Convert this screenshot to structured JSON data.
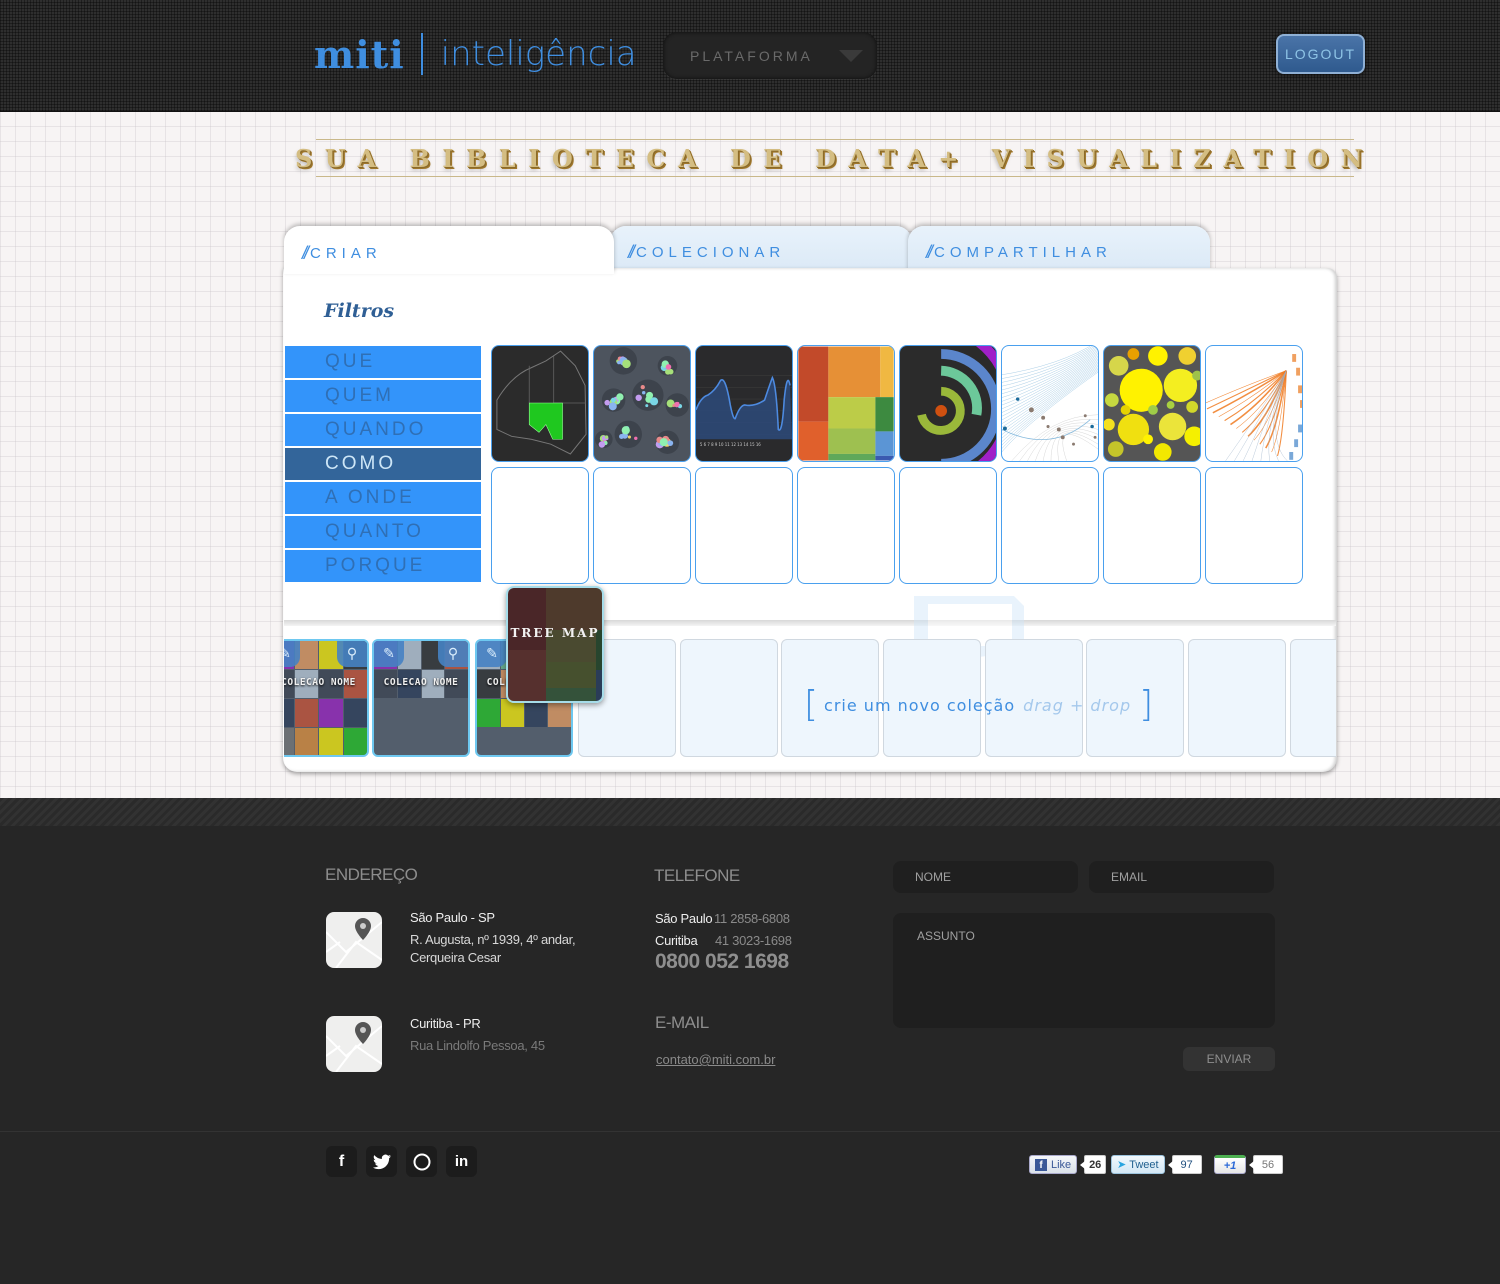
{
  "header": {
    "brand": "miti",
    "product": "inteligência",
    "platform_dropdown": "PLATAFORMA",
    "logout_label": "LOGOUT"
  },
  "banner": {
    "title": "SUA BIBLIOTECA DE DATA+ VISUALIZATION"
  },
  "tabs": [
    {
      "label": "CRIAR",
      "active": true
    },
    {
      "label": "COLECIONAR",
      "active": false
    },
    {
      "label": "COMPARTILHAR",
      "active": false
    }
  ],
  "filters": {
    "title": "Filtros",
    "items": [
      {
        "label": "QUE",
        "active": false
      },
      {
        "label": "QUEM",
        "active": false
      },
      {
        "label": "QUANDO",
        "active": false
      },
      {
        "label": "COMO",
        "active": true
      },
      {
        "label": "A ONDE",
        "active": false
      },
      {
        "label": "QUANTO",
        "active": false
      },
      {
        "label": "PORQUE",
        "active": false
      }
    ]
  },
  "gallery": {
    "thumbnails": [
      {
        "kind": "choropleth-map"
      },
      {
        "kind": "cluster-bubbles"
      },
      {
        "kind": "area-line-chart"
      },
      {
        "kind": "tree-map"
      },
      {
        "kind": "radial-bar"
      },
      {
        "kind": "network-arcs"
      },
      {
        "kind": "circle-packing"
      },
      {
        "kind": "edge-bundling"
      }
    ],
    "empty_slots": 8
  },
  "collections": {
    "items": [
      {
        "name": "COLECAO NOME",
        "fill": "full"
      },
      {
        "name": "COLECAO NOME",
        "fill": "partial"
      },
      {
        "name": "COLECAO NOME",
        "fill": "partial"
      }
    ],
    "empty_slots": 8,
    "drop_hint": "crie um novo coleção",
    "drop_hint_action": "drag + drop"
  },
  "drag_item": {
    "label": "TREE MAP"
  },
  "footer": {
    "address_heading": "ENDEREÇO",
    "addresses": [
      {
        "city": "São Paulo - SP",
        "line1": "R. Augusta, nº 1939, 4º andar,",
        "line2": "Cerqueira Cesar"
      },
      {
        "city": "Curitiba - PR",
        "line1": "Rua Lindolfo Pessoa, 45",
        "line2": ""
      }
    ],
    "phone_heading": "TELEFONE",
    "phones": [
      {
        "city": "São Paulo",
        "number": "11 2858-6808"
      },
      {
        "city": "Curitiba",
        "number": "41 3023-1698"
      }
    ],
    "toll_free": "0800 052 1698",
    "email_heading": "E-MAIL",
    "email": "contato@miti.com.br",
    "form": {
      "name_placeholder": "NOME",
      "email_placeholder": "EMAIL",
      "subject_placeholder": "ASSUNTO",
      "send_label": "ENVIAR"
    },
    "social": [
      {
        "name": "facebook",
        "glyph": "f"
      },
      {
        "name": "twitter",
        "glyph": "t"
      },
      {
        "name": "circle",
        "glyph": "o"
      },
      {
        "name": "linkedin",
        "glyph": "in"
      }
    ],
    "share": {
      "like_label": "Like",
      "like_count": "26",
      "tweet_label": "Tweet",
      "tweet_count": "97",
      "plusone_label": "+1",
      "plusone_count": "56"
    }
  }
}
